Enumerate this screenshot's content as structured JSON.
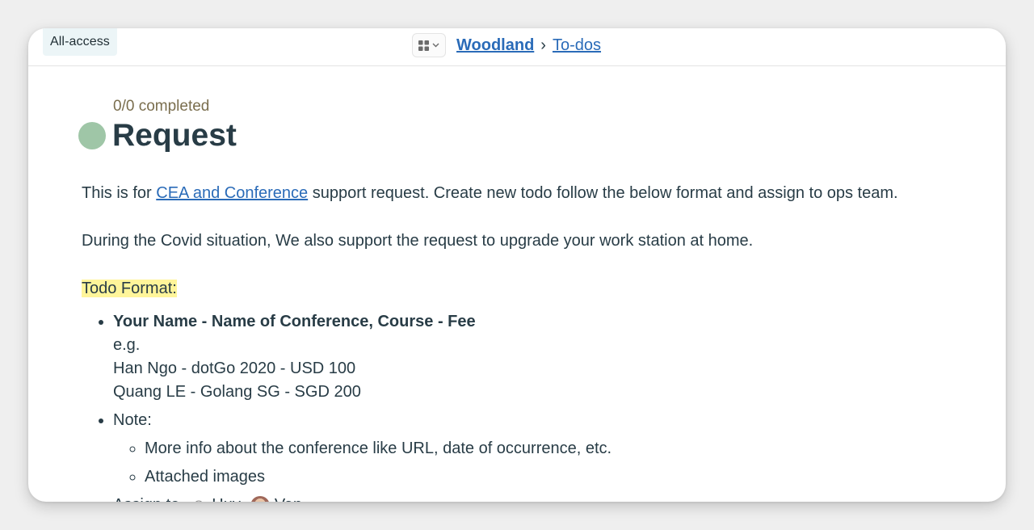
{
  "topbar": {
    "access_badge": "All-access",
    "switcher_icon": "grid-icon",
    "breadcrumb": {
      "project": "Woodland",
      "separator": "›",
      "section": "To-dos"
    }
  },
  "todo": {
    "progress": "0/0 completed",
    "title": "Request",
    "status_color": "#9fc6a7",
    "intro_before": "This is for ",
    "intro_link": "CEA and Conference",
    "intro_after": " support request. Create new todo follow the below format and assign to ops team.",
    "covid_note": "During the Covid situation, We also support the request to upgrade your work station at home.",
    "format_heading": "Todo Format:",
    "items": [
      {
        "heading": "Your Name - Name of Conference, Course - Fee",
        "lines": [
          "e.g.",
          "Han Ngo - dotGo 2020 - USD 100",
          "Quang LE - Golang SG - SGD 200"
        ]
      },
      {
        "label": "Note:",
        "subitems": [
          "More info about the conference like URL, date of occurrence, etc.",
          "Attached images"
        ]
      },
      {
        "label": "Assign to",
        "assignees": [
          {
            "name": "Huy",
            "avatar": "placeholder-avatar-icon"
          },
          {
            "name": "Van",
            "avatar": "photo-avatar"
          }
        ]
      }
    ]
  },
  "colors": {
    "link": "#2a6bb8",
    "text": "#283c46",
    "highlight": "#fff59a",
    "progress_text": "#7a6e4e"
  }
}
